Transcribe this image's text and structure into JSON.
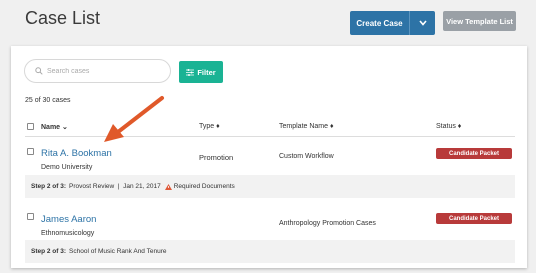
{
  "header": {
    "title": "Case List",
    "create_label": "Create Case",
    "view_template_label": "View Template List"
  },
  "search": {
    "placeholder": "Search cases"
  },
  "filter": {
    "label": "Filter"
  },
  "count_text": "25 of 30 cases",
  "columns": {
    "name": "Name ⌄",
    "type": "Type ♦",
    "template": "Template Name ♦",
    "status": "Status ♦"
  },
  "rows": [
    {
      "name": "Rita A. Bookman",
      "institution": "Demo University",
      "type": "Promotion",
      "template": "Custom Workflow",
      "status": "Candidate Packet",
      "step_label": "Step 2 of 3:",
      "step_text": "Provost Review  |  Jan 21, 2017",
      "alert_text": "Required Documents"
    },
    {
      "name": "James Aaron",
      "institution": "Ethnomusicology",
      "type": "",
      "template": "Anthropology Promotion Cases",
      "status": "Candidate Packet",
      "step_label": "Step 2 of 3:",
      "step_text": "School of Music Rank And Tenure"
    }
  ],
  "colors": {
    "primary": "#2d73a6",
    "filter": "#1ab394",
    "status_badge": "#b83a3a",
    "annotation_arrow": "#e0592a",
    "alert": "#e05a3a"
  }
}
